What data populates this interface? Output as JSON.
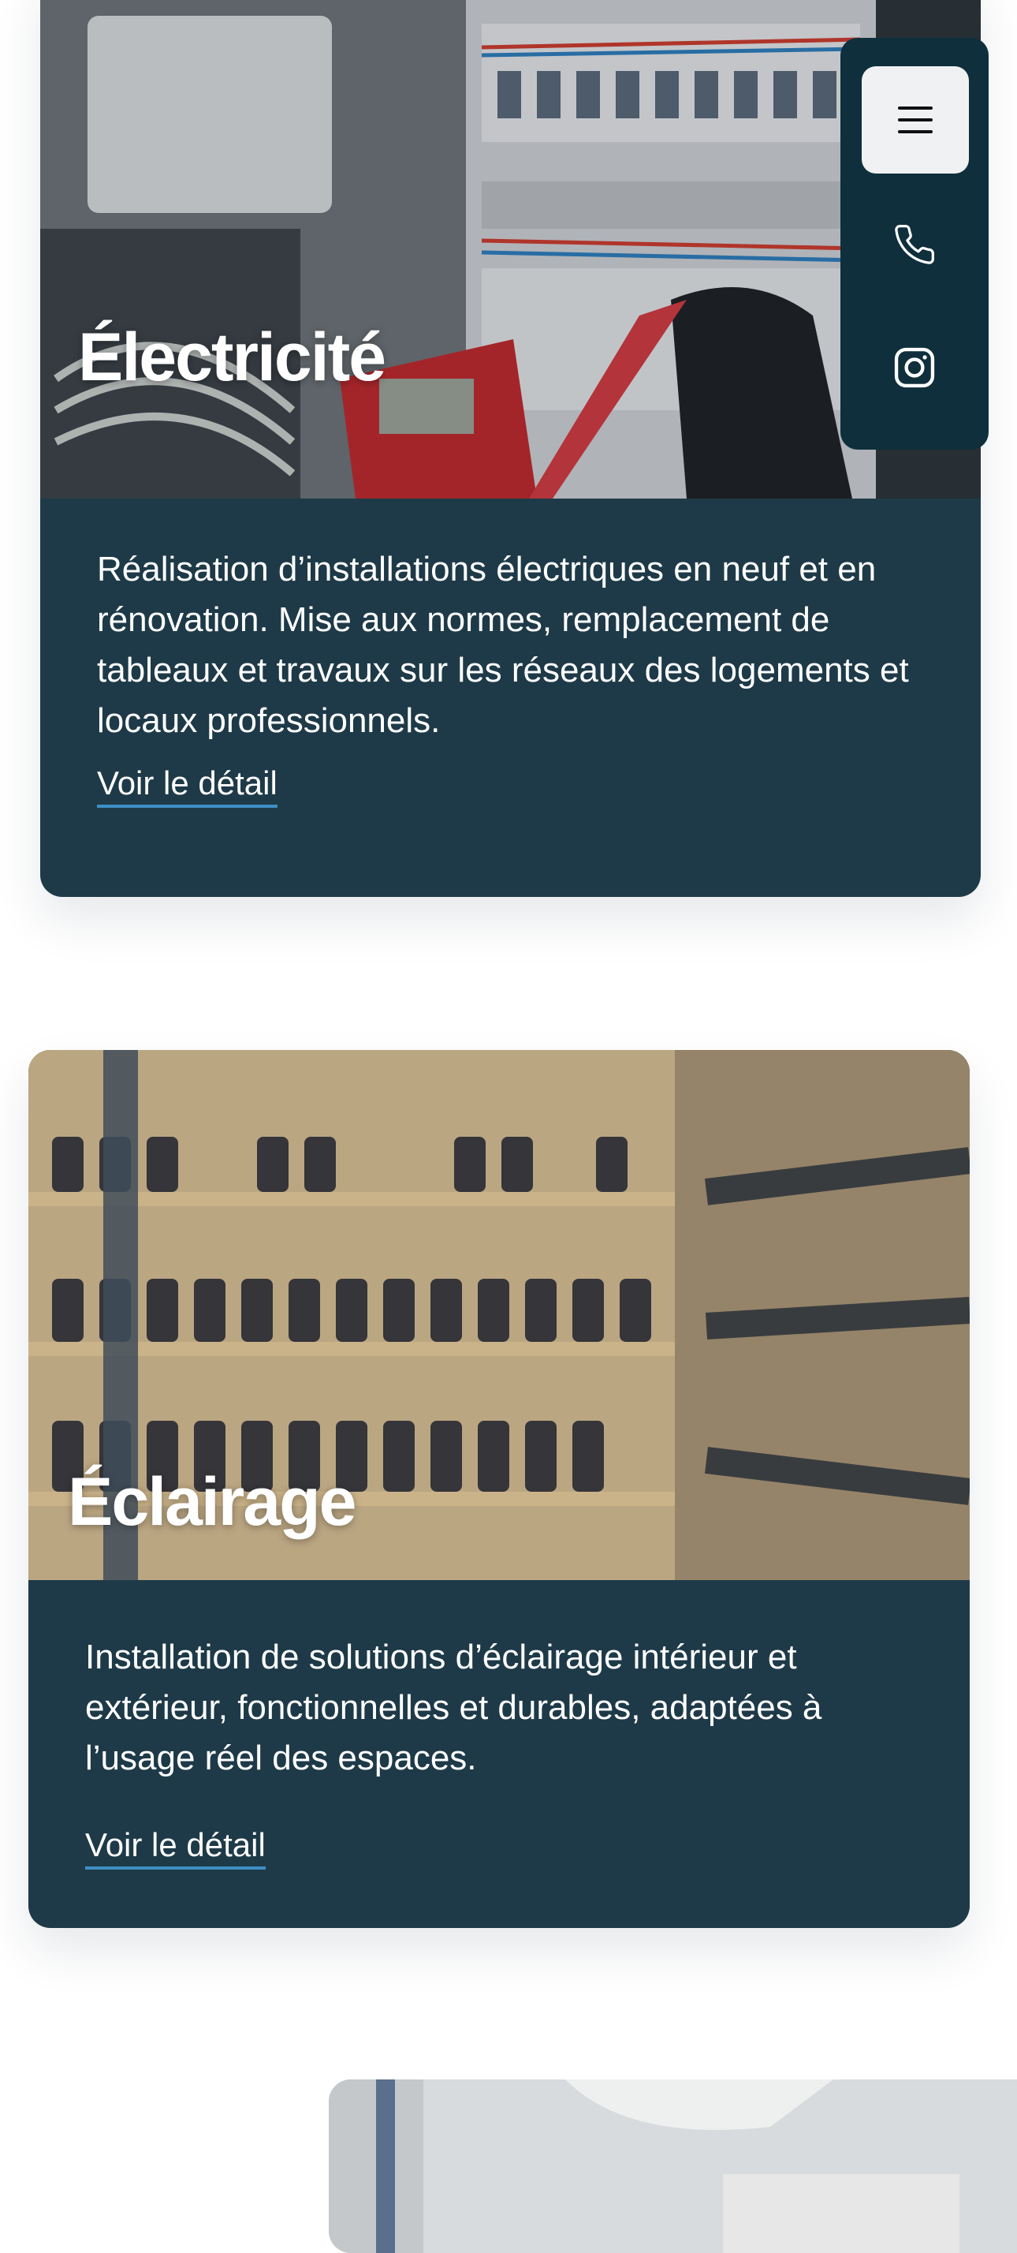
{
  "cards": [
    {
      "title": "Électricité",
      "description": "Réalisation d’installations électriques en neuf et en rénovation. Mise aux normes, remplacement de tableaux et travaux sur les réseaux des logements et locaux professionnels.",
      "link_label": "Voir le détail"
    },
    {
      "title": "Éclairage",
      "description": "Installation de solutions d’éclairage intérieur et extérieur, fonctionnelles et durables, adaptées à l’usage réel des espaces.",
      "link_label": "Voir le détail"
    }
  ],
  "side_bar": {
    "icons": [
      "menu-icon",
      "phone-icon",
      "instagram-icon"
    ]
  },
  "colors": {
    "card_background": "#1e3a48",
    "side_bar": "#0f2f3c",
    "link_underline": "#3d8fc4"
  }
}
